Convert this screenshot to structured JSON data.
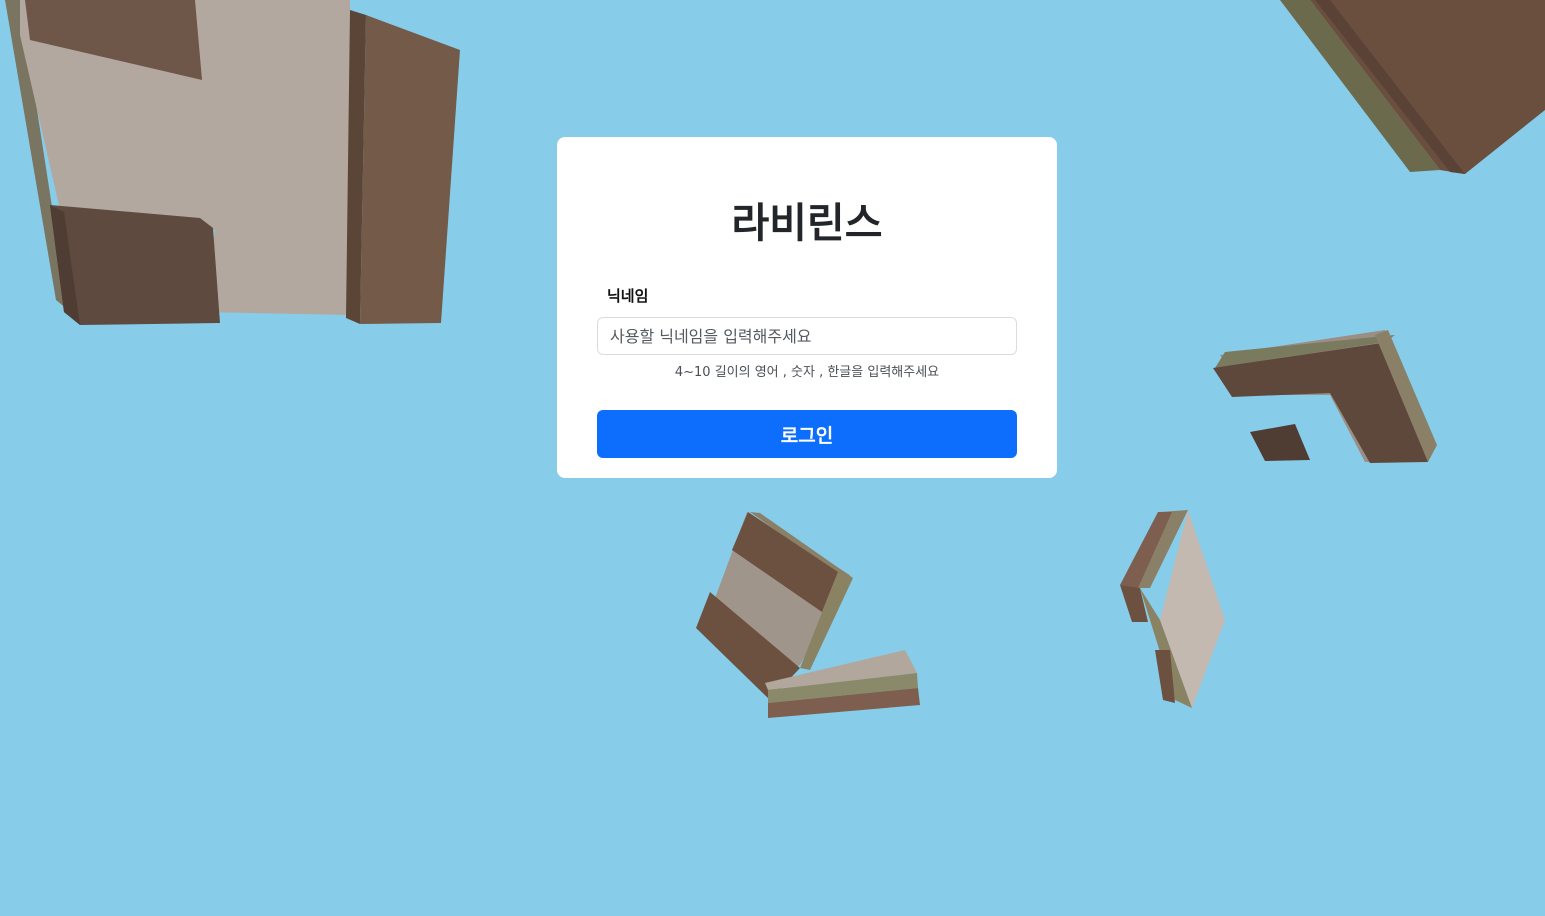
{
  "login": {
    "title": "라비린스",
    "nickname_label": "닉네임",
    "nickname_placeholder": "사용할 닉네임을 입력해주세요",
    "nickname_value": "",
    "hint": "4~10 길이의 영어 , 숫자 , 한글을 입력해주세요",
    "submit_label": "로그인"
  },
  "colors": {
    "background": "#87cdea",
    "button": "#0d6efd",
    "card": "#ffffff"
  }
}
